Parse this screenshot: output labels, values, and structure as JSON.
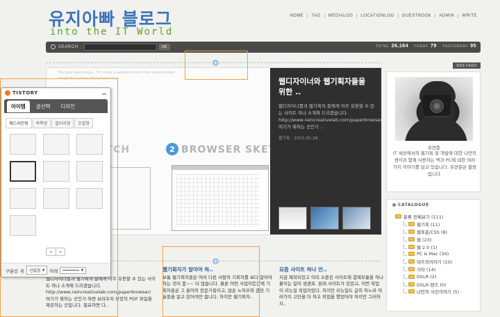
{
  "header": {
    "blog_title": "유지아빠 블로그",
    "subtitle": "into the IT World",
    "nav": [
      "HOME",
      "TAG",
      "MEDIALOG",
      "LOCATIONLOG",
      "GUESTBOOK",
      "ADMIN",
      "WRITE"
    ]
  },
  "searchbar": {
    "label": "SEARCH",
    "button": "OK",
    "placeholder": "",
    "stats": [
      {
        "label": "TOTAL",
        "value": "26,164"
      },
      {
        "label": "TODAY",
        "value": "79"
      },
      {
        "label": "YESTERDAY",
        "value": "95"
      }
    ]
  },
  "rss_label": "RSS FEED",
  "feature": {
    "faint_text": "The goal was simple - To create a wireframe tool that would enable designers to have that perspective.",
    "sketch_left": "ETCH",
    "badge": "2",
    "sketch_right": "BROWSER SKETCH",
    "title": "웹디자이너와 웹기획자들을 위한 ..",
    "desc": "웹디자이너를과 웹기획자 들에게 아주 유용할 수 있는 사이트 하나 소개해 드리겠습니다. http://www.raincreativelab.com/paperbrowser/ 여기가 뭐하는 곳인가 ..",
    "meta": "웹기획 · 2010.05.28"
  },
  "articles": [
    {
      "title": "",
      "body": "웹디자이너를과 웹기획자 들에게 아주 유용할 수 있는 사이트 하나 소개해 드리겠습니다. http://www.raincreativelab.com/paperbrowser/ 여기가 뭐하는 곳인가 하면 브라우저 모양의 PDF 파일을 제공하는 곳입니다. 필요하면 다.."
    },
    {
      "title": "웹기획자가 알아야 하..",
      "body": "보통 웹기획자들은 여러 다른 사람의 기획자를 보다 알아야 하는 것이 좀~~ 더 많습니다. 물론 어떤 사업이든간에 기획자들은 그 분야의 전문가들이고, 많은 노하우와 관련 기술들을 알고 있어야만 합니다. 하지만 웹기획자.."
    },
    {
      "title": "요즘 사이트 하나 만..",
      "body": "지금 제작되었고 이미 오픈된 사이트에 결제모듈을 하나 붙이는 일이 생겼죠. 원래 사이트가 있었고, 이번 작업이 리뉴얼 작업이었다. 하지만 리뉴얼도 급히 하느라 여러가지 고민을 더 하고 작업을 했었어야 하지만 그러하지.."
    }
  ],
  "profile": {
    "name": "유연준",
    "desc": "IT 세상에서의 웹기획 및 개발에 대한 나만의 생각과 함께 사용하는 맥과 PC에 대한 여러가지 이야기를 담고 있습니다. 유연준은 팔랑입니다."
  },
  "catalogue": {
    "heading": "CATALOGUE",
    "items": [
      {
        "label": "분류 전체보기 (111)",
        "sub": false
      },
      {
        "label": "웹기획 (11)",
        "sub": true
      },
      {
        "label": "웹표준/CSS (8)",
        "sub": true
      },
      {
        "label": "웹 (23)",
        "sub": true
      },
      {
        "label": "웹 2.0 (1)",
        "sub": true
      },
      {
        "label": "PC & Mac (34)",
        "sub": true
      },
      {
        "label": "데주의이야기 (10)",
        "sub": true
      },
      {
        "label": "기타 (14)",
        "sub": true
      },
      {
        "label": "DSLR (2)",
        "sub": true
      },
      {
        "label": "DSLR 렌즈 (0)",
        "sub": true
      },
      {
        "label": "나만의 사진이야기 (5)",
        "sub": true
      }
    ]
  },
  "tistory_panel": {
    "brand": "TISTORY",
    "tabs": [
      "아이템",
      "글선택",
      "디자인"
    ],
    "subtabs": [
      "헤드라인형",
      "목록형",
      "갤러리형",
      "조합형"
    ],
    "pager": [
      "<",
      ">"
    ],
    "footer": {
      "label1": "구분선",
      "label2": "위",
      "select1": "선없음",
      "label3": "아래"
    }
  },
  "colors": {
    "title_blue": "#3d74b8",
    "subtitle_green": "#5aa629",
    "highlight_orange": "#f2a141",
    "dark_bar": "#4a4a4a"
  }
}
